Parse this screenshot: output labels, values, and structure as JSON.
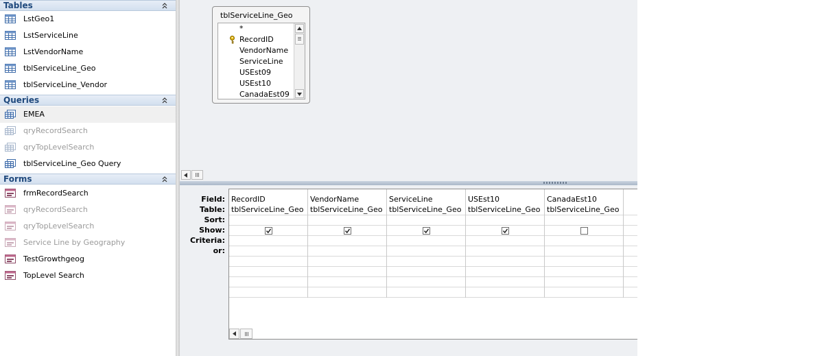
{
  "nav": {
    "groups": [
      {
        "title": "Tables",
        "items": [
          {
            "label": "LstGeo1",
            "icon": "table-icon"
          },
          {
            "label": "LstServiceLine",
            "icon": "table-icon"
          },
          {
            "label": "LstVendorName",
            "icon": "table-icon"
          },
          {
            "label": "tblServiceLine_Geo",
            "icon": "table-icon"
          },
          {
            "label": "tblServiceLine_Vendor",
            "icon": "table-icon"
          }
        ]
      },
      {
        "title": "Queries",
        "items": [
          {
            "label": "EMEA",
            "icon": "query-icon"
          },
          {
            "label": "qryRecordSearch",
            "icon": "query-icon"
          },
          {
            "label": "qryTopLevelSearch",
            "icon": "query-icon"
          },
          {
            "label": "tblServiceLine_Geo Query",
            "icon": "query-icon"
          }
        ]
      },
      {
        "title": "Forms",
        "items": [
          {
            "label": "frmRecordSearch",
            "icon": "form-icon"
          },
          {
            "label": "qryRecordSearch",
            "icon": "form-icon"
          },
          {
            "label": "qryTopLevelSearch",
            "icon": "form-icon"
          },
          {
            "label": "Service Line by Geography",
            "icon": "form-icon"
          },
          {
            "label": "TestGrowthgeog",
            "icon": "form-icon"
          },
          {
            "label": "TopLevel Search",
            "icon": "form-icon"
          }
        ]
      }
    ]
  },
  "table_box": {
    "title": "tblServiceLine_Geo",
    "fields": [
      "*",
      "RecordID",
      "VendorName",
      "ServiceLine",
      "USEst09",
      "USEst10",
      "CanadaEst09"
    ]
  },
  "grid": {
    "row_labels": [
      "Field:",
      "Table:",
      "Sort:",
      "Show:",
      "Criteria:",
      "or:"
    ],
    "columns": [
      {
        "field": "RecordID",
        "table": "tblServiceLine_Geo",
        "show": true
      },
      {
        "field": "VendorName",
        "table": "tblServiceLine_Geo",
        "show": true
      },
      {
        "field": "ServiceLine",
        "table": "tblServiceLine_Geo",
        "show": true
      },
      {
        "field": "USEst10",
        "table": "tblServiceLine_Geo",
        "show": true
      },
      {
        "field": "CanadaEst10",
        "table": "tblServiceLine_Geo",
        "show": false
      }
    ]
  },
  "colors": {
    "nav_header": "#1f497d",
    "dim_text": "#9a9a9a",
    "workspace": "#eef0f3"
  }
}
